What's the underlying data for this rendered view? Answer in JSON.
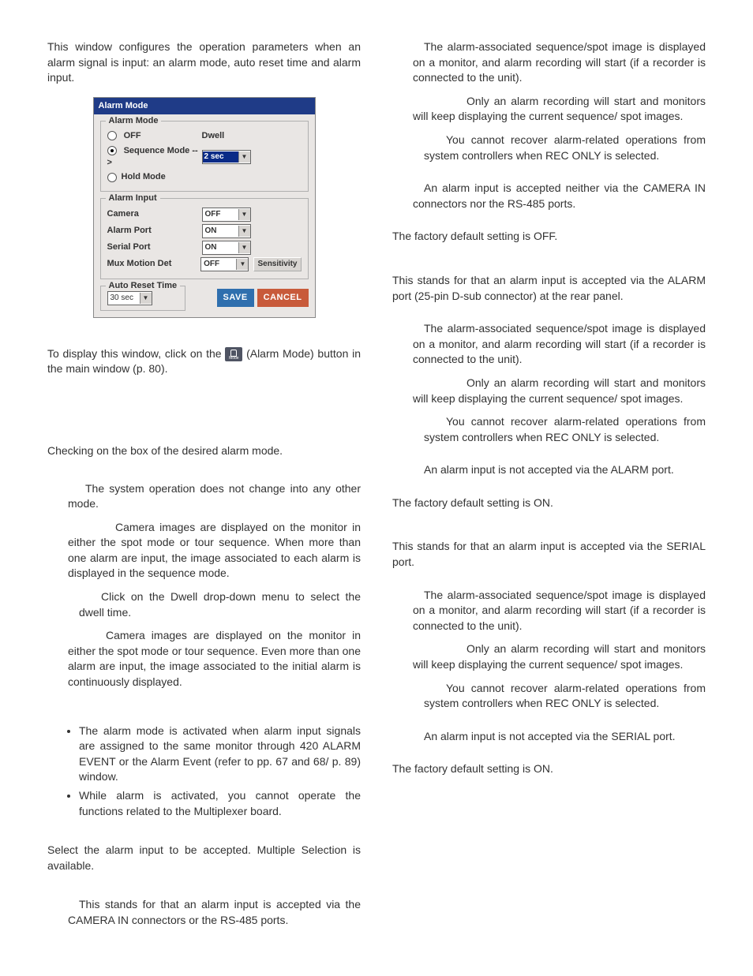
{
  "left": {
    "intro": "This window configures the operation parameters when an alarm signal is input: an alarm mode, auto reset time and alarm input.",
    "dialog": {
      "title": "Alarm Mode",
      "group_mode": "Alarm Mode",
      "opt_off": "OFF",
      "opt_seq": "Sequence Mode -->",
      "opt_hold": "Hold Mode",
      "dwell_label": "Dwell",
      "dwell_value": "2 sec",
      "group_input": "Alarm Input",
      "camera": "Camera",
      "camera_val": "OFF",
      "alarm_port": "Alarm Port",
      "alarm_port_val": "ON",
      "serial_port": "Serial Port",
      "serial_port_val": "ON",
      "mux": "Mux Motion Det",
      "mux_val": "OFF",
      "sensitivity": "Sensitivity",
      "group_reset": "Auto Reset Time",
      "reset_val": "30 sec",
      "save": "SAVE",
      "cancel": "CANCEL"
    },
    "display1": "To display this window, click on the ",
    "display2": " (Alarm Mode) button in the main window (p. 80).",
    "checkline": "Checking on the box of the desired alarm mode.",
    "para_sys": "The system operation does not change into any other mode.",
    "para_seq": "Camera images are displayed on the monitor in either the spot mode or tour sequence. When more than one alarm are input, the image associated to each alarm is displayed in the sequence mode.",
    "para_dwell": "Click on the Dwell drop-down menu to select the dwell time.",
    "para_hold": "Camera images are displayed on the monitor in either the spot mode or tour sequence.  Even more than one alarm are input, the image associated to the initial alarm is continuously displayed.",
    "bullet1": "The alarm mode is activated when alarm input signals are assigned to the same monitor through 420 ALARM EVENT or the Alarm Event (refer to pp. 67 and 68/ p. 89) window.",
    "bullet2": "While alarm is activated, you cannot operate the functions related to the Multiplexer board.",
    "select_input": "Select the alarm input to be accepted. Multiple Selection is available.",
    "camera_in": "This stands for that an alarm input is accepted via the CAMERA IN connectors or the RS-485 ports."
  },
  "right": {
    "assoc1": "The alarm-associated sequence/spot image is displayed on a monitor, and alarm recording will start (if a recorder is connected to the unit).",
    "reconly1": "Only an alarm recording will start and monitors will keep displaying the current sequence/ spot images.",
    "note_reconly1": "You cannot recover alarm-related operations from system controllers when REC ONLY is selected.",
    "off_camera": "An alarm input is accepted neither via the CAMERA IN connectors nor the RS-485 ports.",
    "default_off": "The factory default setting is OFF.",
    "alarm_port_desc": "This stands for that an alarm input is accepted via the ALARM port (25-pin D-sub connector) at the rear panel.",
    "assoc2": "The alarm-associated sequence/spot image is displayed on a monitor, and alarm recording will start (if a recorder is connected to the unit).",
    "reconly2": "Only an alarm recording will start and monitors will keep displaying the current sequence/ spot images.",
    "note_reconly2": "You cannot recover alarm-related operations from system controllers when REC ONLY is selected.",
    "off_alarm": "An alarm input is not accepted via the ALARM port.",
    "default_on1": "The factory default setting is ON.",
    "serial_desc": "This stands for that an alarm input is accepted via the SERIAL port.",
    "assoc3": "The alarm-associated sequence/spot image is displayed on a monitor, and alarm recording will start (if a recorder is connected to the unit).",
    "reconly3": "Only an alarm recording will start and monitors will keep displaying the current sequence/ spot images.",
    "note_reconly3": "You cannot recover alarm-related operations from system controllers when REC ONLY is selected.",
    "off_serial": "An alarm input is not accepted via the SERIAL port.",
    "default_on2": "The factory default setting is ON."
  }
}
